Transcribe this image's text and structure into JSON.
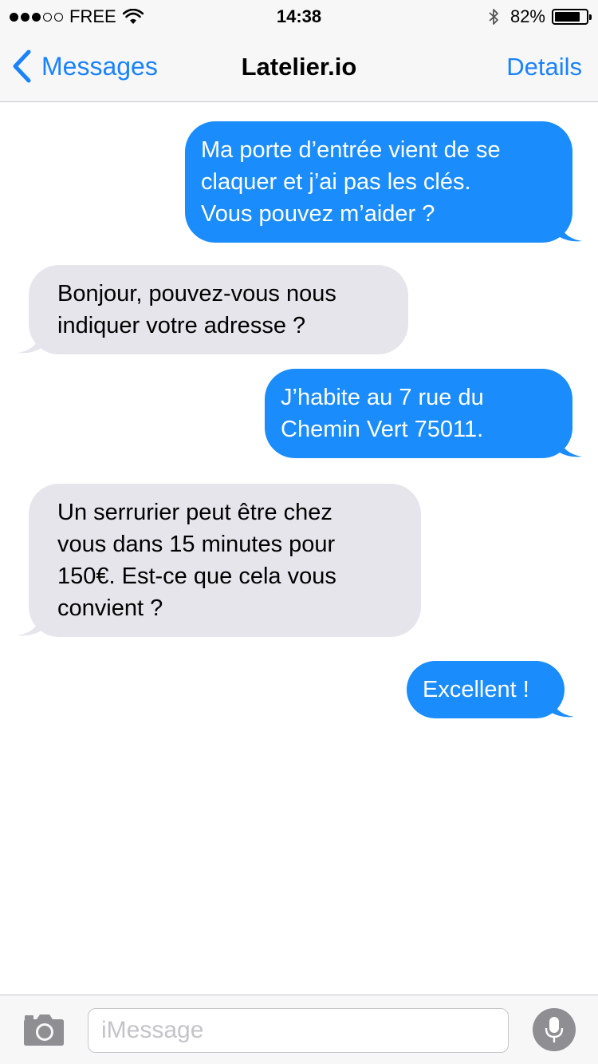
{
  "status_bar": {
    "carrier": "FREE",
    "signal_bars_filled": 3,
    "signal_bars_total": 5,
    "time": "14:38",
    "battery_percent_label": "82%",
    "battery_level": 0.82
  },
  "nav": {
    "back_label": "Messages",
    "title": "Latelier.io",
    "details_label": "Details"
  },
  "messages": [
    {
      "direction": "out",
      "text": "Ma porte d’entrée vient de se\nclaquer et j’ai pas les clés.\nVous pouvez m’aider ?"
    },
    {
      "direction": "in",
      "text": "Bonjour, pouvez-vous nous\nindiquer votre adresse ?"
    },
    {
      "direction": "out",
      "text": "J’habite au 7 rue du\nChemin Vert 75011."
    },
    {
      "direction": "in",
      "text": "Un serrurier peut être chez\nvous dans 15 minutes pour\n150€. Est-ce que cela vous\nconvient ?"
    },
    {
      "direction": "out",
      "text": "Excellent !"
    }
  ],
  "input_bar": {
    "placeholder": "iMessage",
    "value": ""
  },
  "colors": {
    "accent": "#1a82fb",
    "outgoing_bubble": "#1a8cfb",
    "incoming_bubble": "#e6e5eb"
  },
  "icons": {
    "signal": "signal-dots-icon",
    "wifi": "wifi-icon",
    "bluetooth": "bluetooth-icon",
    "battery": "battery-icon",
    "back": "chevron-left-icon",
    "camera": "camera-icon",
    "microphone": "microphone-icon"
  }
}
